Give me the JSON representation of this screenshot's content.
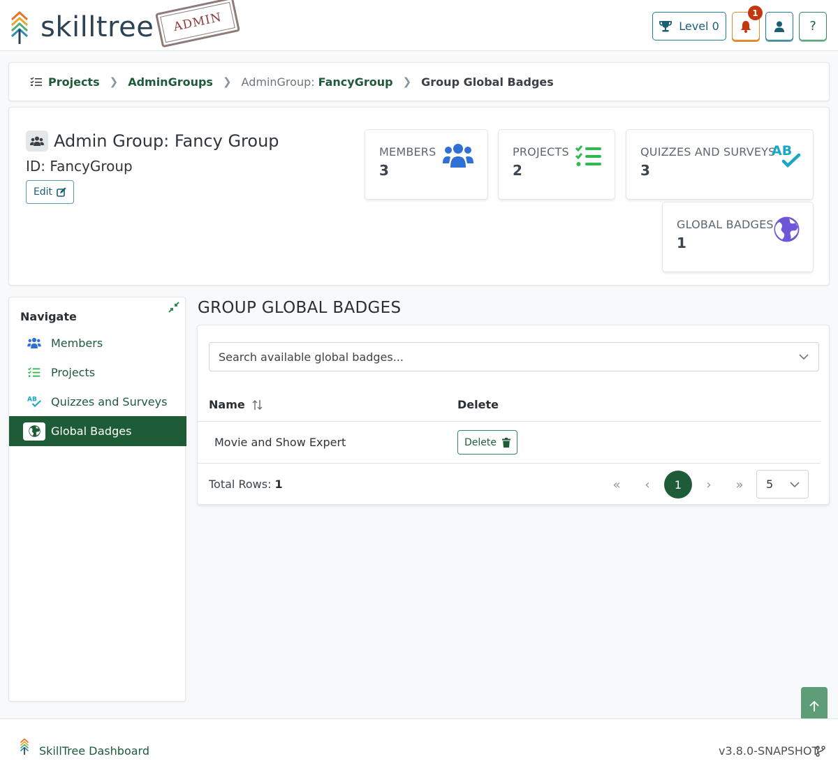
{
  "header": {
    "logo_text": "skilltree",
    "admin_stamp": "ADMIN",
    "level_label": "Level 0",
    "notification_count": "1",
    "help_label": "?"
  },
  "breadcrumb": {
    "projects": "Projects",
    "admin_groups": "AdminGroups",
    "group_prefix": "AdminGroup:",
    "group_name": "FancyGroup",
    "current": "Group Global Badges"
  },
  "group": {
    "title": "Admin Group: Fancy Group",
    "id_text": "ID: FancyGroup",
    "edit_label": "Edit"
  },
  "stats": [
    {
      "label": "MEMBERS",
      "value": "3",
      "icon": "users-icon",
      "color": "#2f6fd6"
    },
    {
      "label": "PROJECTS",
      "value": "2",
      "icon": "list-check-icon",
      "color": "#2dbb4f"
    },
    {
      "label": "QUIZZES AND SURVEYS",
      "value": "3",
      "icon": "spell-check-icon",
      "color": "#1aa6c6"
    },
    {
      "label": "GLOBAL BADGES",
      "value": "1",
      "icon": "globe-icon",
      "color": "#6f55d8"
    }
  ],
  "nav": {
    "title": "Navigate",
    "items": [
      {
        "label": "Members",
        "icon": "users-icon"
      },
      {
        "label": "Projects",
        "icon": "list-check-icon"
      },
      {
        "label": "Quizzes and Surveys",
        "icon": "spell-check-icon"
      },
      {
        "label": "Global Badges",
        "icon": "globe-icon",
        "active": true
      }
    ]
  },
  "main": {
    "title": "GROUP GLOBAL BADGES",
    "search_placeholder": "Search available global badges...",
    "columns": [
      "Name",
      "Delete"
    ],
    "rows": [
      {
        "name": "Movie and Show Expert",
        "action": "Delete"
      }
    ],
    "total_label": "Total Rows:",
    "total_value": "1",
    "current_page": "1",
    "page_size": "5"
  },
  "footer": {
    "link": "SkillTree Dashboard",
    "version": "v3.8.0-SNAPSHOT"
  },
  "colors": {
    "primary_green": "#1d5c37",
    "teal": "#1a7d99",
    "warning": "#e28b2c",
    "danger": "#c4360f"
  }
}
